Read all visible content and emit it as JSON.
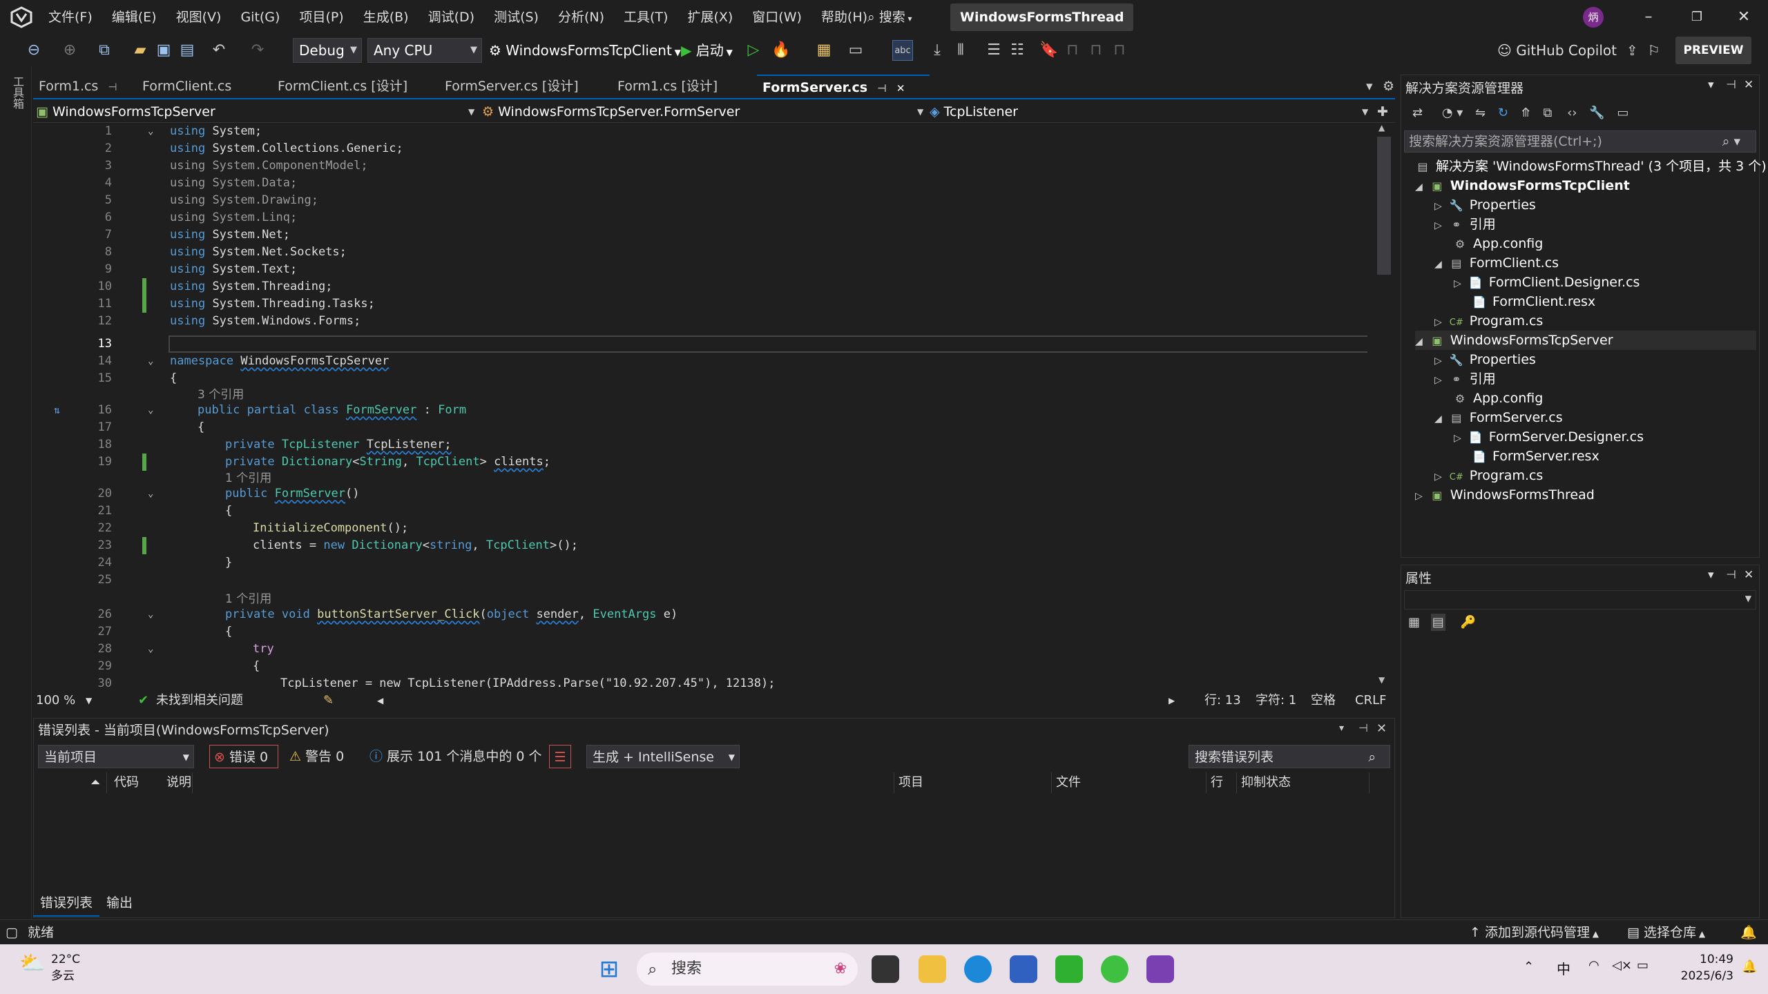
{
  "menubar": {
    "items": [
      "文件(F)",
      "编辑(E)",
      "视图(V)",
      "Git(G)",
      "项目(P)",
      "生成(B)",
      "调试(D)",
      "测试(S)",
      "分析(N)",
      "工具(T)",
      "扩展(X)",
      "窗口(W)",
      "帮助(H)"
    ],
    "search": "搜索",
    "solution_title": "WindowsFormsThread",
    "avatar": "炳"
  },
  "toolbar": {
    "config": "Debug",
    "platform": "Any CPU",
    "project": "WindowsFormsTcpClient",
    "start": "启动",
    "copilot": "GitHub Copilot",
    "preview": "PREVIEW"
  },
  "sidestrip": {
    "label": "工具箱"
  },
  "tabs": [
    {
      "label": "Form1.cs"
    },
    {
      "label": "FormClient.cs"
    },
    {
      "label": "FormClient.cs [设计]"
    },
    {
      "label": "FormServer.cs [设计]"
    },
    {
      "label": "Form1.cs [设计]"
    },
    {
      "label": "FormServer.cs"
    }
  ],
  "nav": {
    "project": "WindowsFormsTcpServer",
    "class": "WindowsFormsTcpServer.FormServer",
    "member": "TcpListener"
  },
  "code": {
    "l1": "1",
    "l2": "2",
    "l3": "3",
    "l4": "4",
    "l5": "5",
    "l6": "6",
    "l7": "7",
    "l8": "8",
    "l9": "9",
    "l10": "10",
    "l11": "11",
    "l12": "12",
    "l13": "13",
    "l14": "14",
    "l15": "15",
    "l16": "16",
    "l17": "17",
    "l18": "18",
    "l19": "19",
    "l20": "20",
    "l21": "21",
    "l22": "22",
    "l23": "23",
    "l24": "24",
    "l25": "25",
    "l26": "26",
    "l27": "27",
    "l28": "28",
    "l29": "29",
    "l30": "30",
    "using": "using",
    "u1": "System;",
    "u2": "System.Collections.Generic;",
    "u3": "System.ComponentModel;",
    "u4": "System.Data;",
    "u5": "System.Drawing;",
    "u6": "System.Linq;",
    "u7": "System.Net;",
    "u8": "System.Net.Sockets;",
    "u9": "System.Text;",
    "u10": "System.Threading;",
    "u11": "System.Threading.Tasks;",
    "u12": "System.Windows.Forms;",
    "namespace": "namespace",
    "ns": "WindowsFormsTcpServer",
    "ob": "{",
    "cb": "}",
    "ref3": "3 个引用",
    "ref1": "1 个引用",
    "public": "public",
    "partial": "partial",
    "class": "class",
    "cls": "FormServer",
    "colon": ":",
    "form": "Form",
    "private": "private",
    "tcpl": "TcpListener",
    "tcplvar": "TcpListener;",
    "dict": "Dictionary",
    "lt": "<",
    "String": "String",
    "comma": ",",
    "tcpc": "TcpClient",
    "gt": ">",
    "clients": "clients",
    "semi": ";",
    "ctor": "FormServer",
    "paren": "()",
    "init": "InitializeComponent",
    "initcall": "();",
    "clientsAssign": "clients =",
    "new": "new",
    "string": "string",
    "call": "();",
    "void": "void",
    "btn": "buttonStartServer_Click",
    "object": "object",
    "sender": "sender",
    "eargs": "EventArgs",
    "e": "e)",
    "try": "try",
    "l30code": "TcpListener = new TcpListener(IPAddress.Parse(\"10.92.207.45\"), 12138);"
  },
  "editor_status": {
    "zoom": "100 %",
    "issues": "未找到相关问题",
    "line": "行: 13",
    "char": "字符: 1",
    "space": "空格",
    "crlf": "CRLF"
  },
  "errors": {
    "title": "错误列表 - 当前项目(WindowsFormsTcpServer)",
    "scope": "当前项目",
    "err": "错误 0",
    "warn": "警告 0",
    "msg": "展示 101 个消息中的 0 个",
    "build": "生成 + IntelliSense",
    "search": "搜索错误列表",
    "cols": [
      "代码",
      "说明",
      "项目",
      "文件",
      "行",
      "抑制状态"
    ]
  },
  "bottomtabs": [
    "错误列表",
    "输出"
  ],
  "solution": {
    "title": "解决方案资源管理器",
    "search": "搜索解决方案资源管理器(Ctrl+;)",
    "items": [
      "解决方案 'WindowsFormsThread' (3 个项目，共 3 个)",
      "WindowsFormsTcpClient",
      "Properties",
      "引用",
      "App.config",
      "FormClient.cs",
      "FormClient.Designer.cs",
      "FormClient.resx",
      "Program.cs",
      "WindowsFormsTcpServer",
      "Properties",
      "引用",
      "App.config",
      "FormServer.cs",
      "FormServer.Designer.cs",
      "FormServer.resx",
      "Program.cs",
      "WindowsFormsThread"
    ]
  },
  "props": {
    "title": "属性"
  },
  "status": {
    "ready": "就绪",
    "add_src": "添加到源代码管理",
    "select_repo": "选择仓库"
  },
  "taskbar": {
    "temp": "22°C",
    "weather": "多云",
    "search": "搜索",
    "ime": "中",
    "time": "10:49",
    "date": "2025/6/3"
  }
}
